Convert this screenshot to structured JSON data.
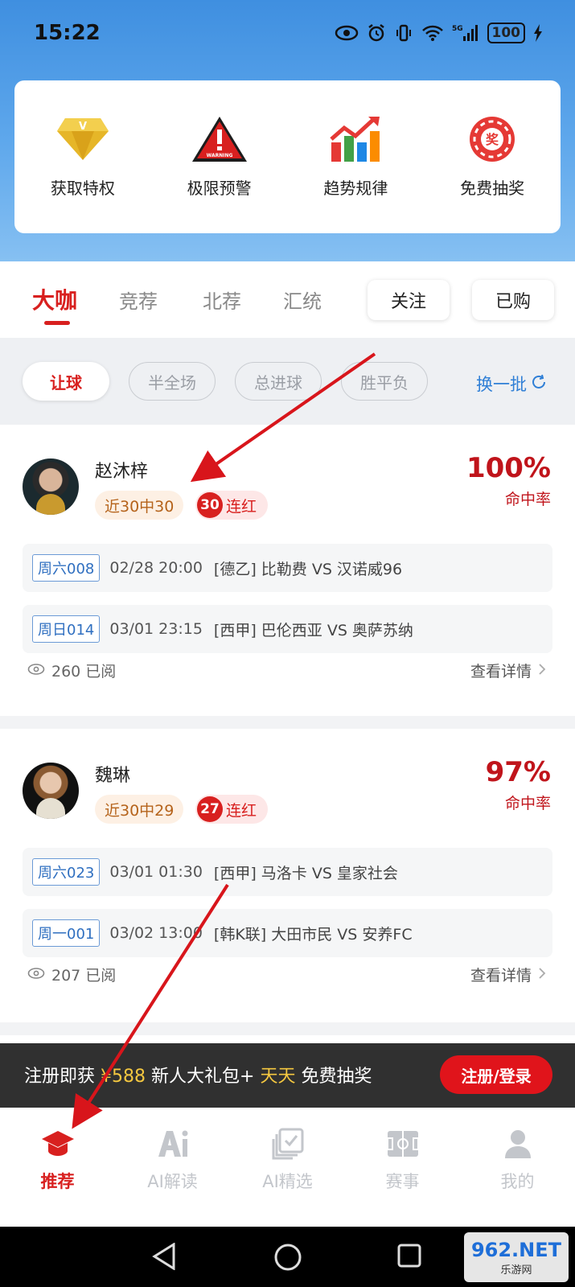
{
  "status_bar": {
    "time": "15:22",
    "battery": "100"
  },
  "features": [
    {
      "label": "获取特权",
      "icon": "diamond-icon"
    },
    {
      "label": "极限预警",
      "icon": "warning-icon",
      "icon_text": "WARNING"
    },
    {
      "label": "趋势规律",
      "icon": "trend-chart-icon"
    },
    {
      "label": "免费抽奖",
      "icon": "lottery-wheel-icon",
      "icon_text": "奖"
    }
  ],
  "tabs": {
    "items": [
      "大咖",
      "竞荐",
      "北荐",
      "汇统"
    ],
    "active": "大咖",
    "follow": "关注",
    "purchased": "已购"
  },
  "filters": {
    "items": [
      "让球",
      "半全场",
      "总进球",
      "胜平负"
    ],
    "active": "让球",
    "refresh": "换一批"
  },
  "experts": [
    {
      "name": "赵沐梓",
      "streak": "近30中30",
      "red_count": "30",
      "red_label": "连红",
      "hit_rate": "100%",
      "hit_label": "命中率",
      "matches": [
        {
          "code": "周六008",
          "time": "02/28 20:00",
          "teams": "[德乙] 比勒费 VS 汉诺威96"
        },
        {
          "code": "周日014",
          "time": "03/01 23:15",
          "teams": "[西甲] 巴伦西亚 VS 奥萨苏纳"
        }
      ],
      "views": "260 已阅",
      "detail": "查看详情"
    },
    {
      "name": "魏琳",
      "streak": "近30中29",
      "red_count": "27",
      "red_label": "连红",
      "hit_rate": "97%",
      "hit_label": "命中率",
      "matches": [
        {
          "code": "周六023",
          "time": "03/01 01:30",
          "teams": "[西甲] 马洛卡 VS 皇家社会"
        },
        {
          "code": "周一001",
          "time": "03/02 13:00",
          "teams": "[韩K联] 大田市民 VS 安养FC"
        }
      ],
      "views": "207 已阅",
      "detail": "查看详情"
    }
  ],
  "register_banner": {
    "prefix": "注册即获",
    "amount": "¥588",
    "middle": "新人大礼包+",
    "highlight": "天天",
    "suffix": "免费抽奖",
    "button": "注册/登录"
  },
  "bottom_nav": [
    {
      "label": "推荐",
      "icon": "graduation-cap-icon",
      "active": true
    },
    {
      "label": "AI解读",
      "icon": "ai-icon",
      "active": false
    },
    {
      "label": "AI精选",
      "icon": "ai-select-icon",
      "active": false
    },
    {
      "label": "赛事",
      "icon": "field-icon",
      "active": false
    },
    {
      "label": "我的",
      "icon": "user-icon",
      "active": false
    }
  ],
  "watermark": {
    "main": "962.NET",
    "sub": "乐游网"
  },
  "colors": {
    "accent": "#d8201f",
    "link": "#2f7fd6",
    "header": "#4a97e4"
  }
}
